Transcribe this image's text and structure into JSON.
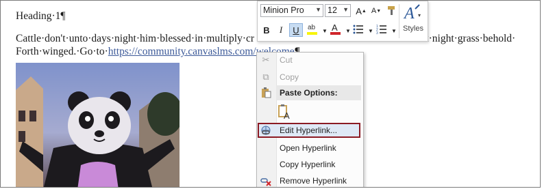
{
  "document": {
    "heading": "Heading·1¶",
    "para_line1_start": "Cattle·don't·unto·days·night·him·blessed·in·multiply·cr",
    "para_line1_end": "ear·let·night·grass·behold·",
    "para_line2_prefix": "Forth·winged.·Go·to·",
    "para_link": "https://community.canvaslms.com/welcome",
    "para_end_mark": "¶"
  },
  "mini_toolbar": {
    "font_name": "Minion Pro",
    "font_size": "12",
    "styles_label": "Styles"
  },
  "context_menu": {
    "items": [
      {
        "label": "Cut",
        "icon": "scissors-icon",
        "disabled": true
      },
      {
        "label": "Copy",
        "icon": "copy-icon",
        "disabled": true
      },
      {
        "label": "Paste Options:",
        "icon": "clipboard-icon",
        "header": true
      },
      {
        "label": "",
        "icon": "paste-keep-text-icon"
      },
      {
        "label": "Edit Hyperlink...",
        "icon": "globe-link-icon",
        "highlighted": true
      },
      {
        "label": "Open Hyperlink",
        "icon": ""
      },
      {
        "label": "Copy Hyperlink",
        "icon": ""
      },
      {
        "label": "Remove Hyperlink",
        "icon": "remove-link-icon"
      }
    ]
  },
  "colors": {
    "highlight_border": "#8b1a23",
    "link": "#3d5a99",
    "font_color_swatch": "#d0252a",
    "highlighter_swatch": "#f7f40a"
  }
}
